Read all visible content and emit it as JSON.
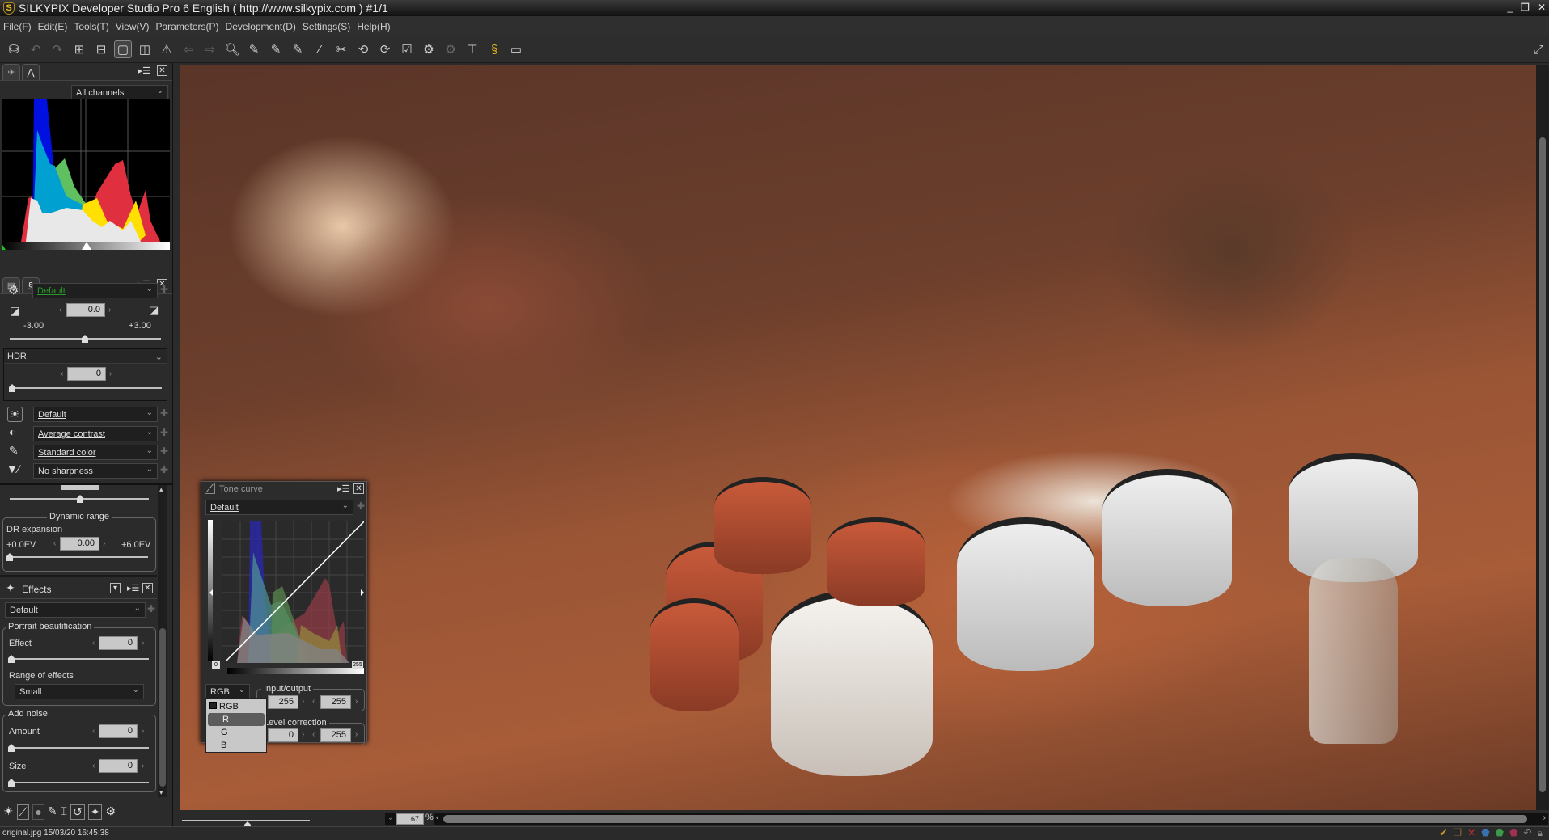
{
  "window": {
    "title": "SILKYPIX Developer Studio Pro 6 English ( http://www.silkypix.com )  #1/1",
    "controls": [
      "_",
      "❐",
      "✕"
    ]
  },
  "menu": [
    "File(F)",
    "Edit(E)",
    "Tools(T)",
    "View(V)",
    "Parameters(P)",
    "Development(D)",
    "Settings(S)",
    "Help(H)"
  ],
  "toolbar": {
    "icons": [
      "develop-icon",
      "undo-icon",
      "redo-icon",
      "grid-view-icon",
      "filmstrip-view-icon",
      "single-view-icon",
      "compare-view-icon",
      "warning-icon",
      "prev-icon",
      "next-icon",
      "zoom-icon",
      "white-balance-picker-icon",
      "gray-picker-icon",
      "black-picker-icon",
      "brush-icon",
      "spot-remove-icon",
      "rotate-left-icon",
      "rotate-right-icon",
      "mark-icon",
      "develop-settings-icon",
      "batch-icon",
      "tools-icon",
      "silkypix-icon",
      "fullscreen-display-icon"
    ]
  },
  "histogram": {
    "channel": "All channels"
  },
  "develop": {
    "preset": "Default",
    "exposure": "0.0",
    "exposure_min": "-3.00",
    "exposure_max": "+3.00",
    "hdr_label": "HDR",
    "hdr_value": "0",
    "white_balance": "Default",
    "contrast": "Average contrast",
    "color": "Standard color",
    "sharpness": "No sharpness",
    "dynamic_range": {
      "title": "Dynamic range",
      "dr_label": "DR expansion",
      "min": "+0.0EV",
      "value": "0.00",
      "max": "+6.0EV"
    }
  },
  "effects": {
    "title": "Effects",
    "preset": "Default",
    "portrait": {
      "title": "Portrait beautification",
      "effect_label": "Effect",
      "effect_value": "0",
      "range_label": "Range of effects",
      "range_value": "Small"
    },
    "noise": {
      "title": "Add noise",
      "amount_label": "Amount",
      "amount_value": "0",
      "size_label": "Size",
      "size_value": "0"
    }
  },
  "tone_curve": {
    "title": "Tone curve",
    "preset": "Default",
    "channel": "RGB",
    "io_title": "Input/output",
    "input": "255",
    "output": "255",
    "level_title": "Level correction",
    "level_low": "0",
    "level_high": "255",
    "min_tag": "0",
    "max_tag": "255",
    "channel_menu": [
      "RGB",
      "R",
      "G",
      "B"
    ],
    "highlighted": "R"
  },
  "viewer": {
    "zoom": "67",
    "zoom_unit": "%"
  },
  "status": {
    "file": "original.jpg 15/03/20 16:45:38"
  }
}
